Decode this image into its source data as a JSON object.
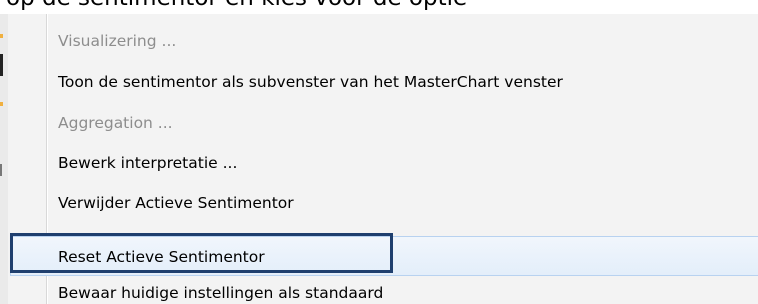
{
  "document": {
    "instruction_text": "op de sentimentor en kies voor de optie"
  },
  "context_menu": {
    "items": [
      {
        "label": "Visualizering ...",
        "enabled": false
      },
      {
        "label": "Toon de sentimentor als subvenster van het MasterChart venster",
        "enabled": true
      },
      {
        "label": "Aggregation ...",
        "enabled": false
      },
      {
        "label": "Bewerk interpretatie ...",
        "enabled": true
      },
      {
        "label": "Verwijder Actieve Sentimentor",
        "enabled": true
      },
      {
        "label": "Reset Actieve Sentimentor",
        "enabled": true,
        "highlighted": true
      },
      {
        "label": "Bewaar huidige instellingen als standaard",
        "enabled": true
      }
    ]
  },
  "colors": {
    "annotation_box": "#1f3f6e",
    "hover_row": "#e3eefa",
    "disabled_text": "#8d8d8d",
    "menu_background": "#f3f3f3"
  }
}
